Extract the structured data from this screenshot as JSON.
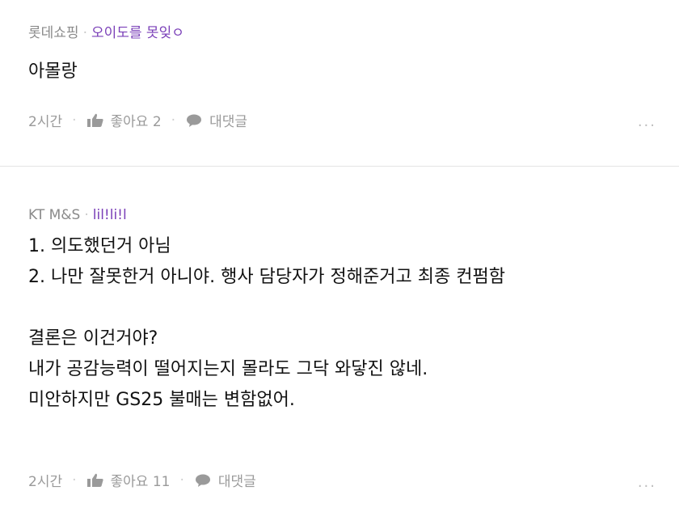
{
  "comments": [
    {
      "author": "롯데쇼핑",
      "nickname": "오이도를 못잊ㅇ",
      "lines": [
        "아몰랑"
      ],
      "time": "2시간",
      "like_label": "좋아요 2",
      "reply_label": "대댓글",
      "more": "···"
    },
    {
      "author": "KT M&S",
      "nickname": "lil!li!l",
      "lines": [
        "1. 의도했던거 아님",
        "2. 나만 잘못한거 아니야. 행사 담당자가 정해준거고 최종 컨펌함",
        "",
        "결론은 이건거야?",
        "내가 공감능력이 떨어지는지 몰라도 그닥 와닿진 않네.",
        "미안하지만 GS25 불매는 변함없어."
      ],
      "time": "2시간",
      "like_label": "좋아요 11",
      "reply_label": "대댓글",
      "more": "···"
    }
  ],
  "separator": "·",
  "icons": {
    "like": "thumbs-up-icon",
    "reply": "speech-bubble-icon",
    "more": "more-dots-icon"
  },
  "colors": {
    "nickname": "#7a3fb8",
    "meta": "#8a8a8a",
    "text": "#111111",
    "divider": "#e4e4e4"
  }
}
